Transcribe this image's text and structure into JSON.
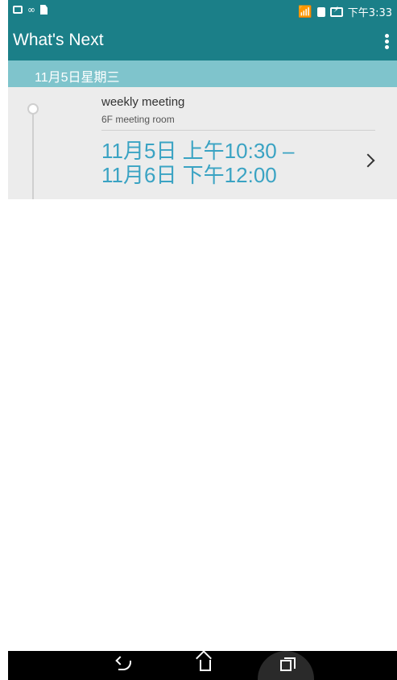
{
  "status_bar": {
    "time": "下午3:33",
    "icons": [
      "calendar-icon",
      "infinity-icon",
      "sd-card-icon",
      "wifi-icon",
      "sim-icon",
      "battery-charging-icon"
    ]
  },
  "app_bar": {
    "title": "What's Next",
    "menu_icon": "overflow-menu-icon"
  },
  "date_header": {
    "label": "11月5日星期三"
  },
  "event": {
    "title": "weekly meeting",
    "location": "6F meeting room",
    "time_start": "11月5日 上午10:30 –",
    "time_end": "11月6日 下午12:00"
  },
  "nav_bar": {
    "icons": [
      "back-icon",
      "home-icon",
      "recent-apps-icon"
    ]
  },
  "colors": {
    "app_bar": "#1b7f88",
    "date_header": "#7fc4cc",
    "event_bg": "#ececec",
    "time_text": "#3aa3c3"
  }
}
